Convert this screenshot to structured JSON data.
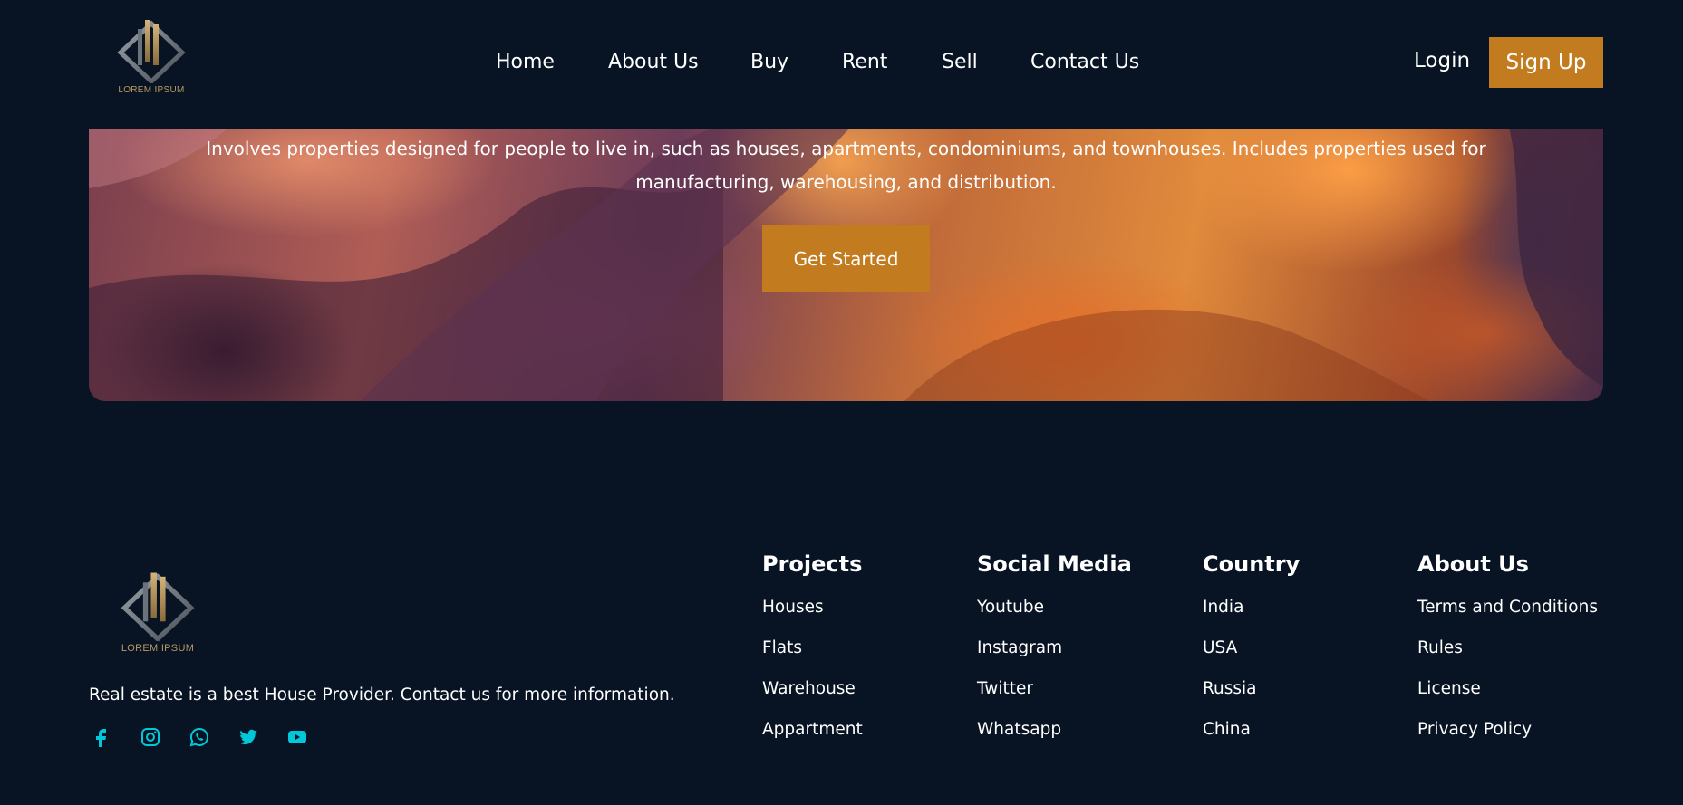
{
  "header": {
    "logo_text": "LOREM IPSUM",
    "nav": [
      "Home",
      "About Us",
      "Buy",
      "Rent",
      "Sell",
      "Contact Us"
    ],
    "login_label": "Login",
    "signup_label": "Sign Up"
  },
  "hero": {
    "text": "Involves properties designed for people to live in, such as houses, apartments, condominiums, and townhouses. Includes properties used for manufacturing, warehousing, and distribution.",
    "cta_label": "Get Started"
  },
  "footer": {
    "logo_text": "LOREM IPSUM",
    "description": "Real estate is a best House Provider. Contact us for more information.",
    "social_icons": [
      "facebook-icon",
      "instagram-icon",
      "whatsapp-icon",
      "twitter-icon",
      "youtube-icon"
    ],
    "accent_color": "#00c8d8",
    "columns": [
      {
        "title": "Projects",
        "links": [
          "Houses",
          "Flats",
          "Warehouse",
          "Appartment"
        ]
      },
      {
        "title": "Social Media",
        "links": [
          "Youtube",
          "Instagram",
          "Twitter",
          "Whatsapp"
        ]
      },
      {
        "title": "Country",
        "links": [
          "India",
          "USA",
          "Russia",
          "China"
        ]
      },
      {
        "title": "About Us",
        "links": [
          "Terms and Conditions",
          "Rules",
          "License",
          "Privacy Policy"
        ]
      }
    ]
  },
  "colors": {
    "background": "#081423",
    "button": "#c27c1f"
  }
}
